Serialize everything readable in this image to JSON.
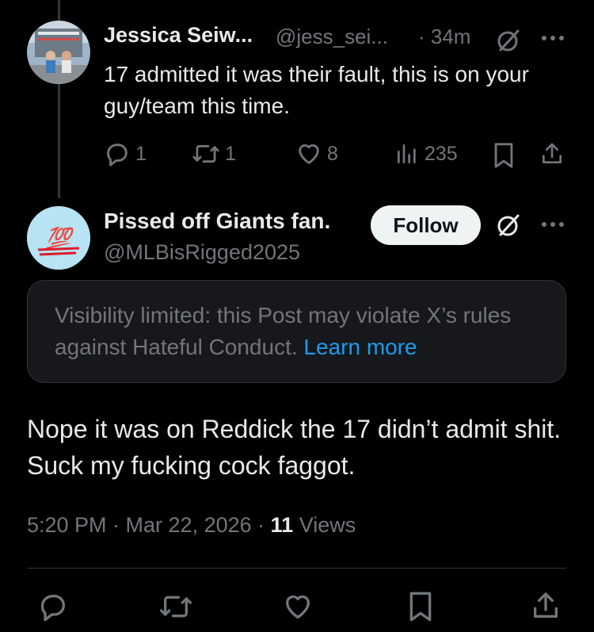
{
  "reply_tweet": {
    "author_name": "Jessica Seiw...",
    "handle": "@jess_sei...",
    "time": "· 34m",
    "text": "17 admitted it was their fault, this is on your guy/team this time.",
    "actions": {
      "replies": "1",
      "reposts": "1",
      "likes": "8",
      "views": "235"
    }
  },
  "main_tweet": {
    "author_name": "Pissed off Giants fan.",
    "handle": "@MLBisRigged2025",
    "avatar_emoji": "💯",
    "follow_label": "Follow",
    "notice_text": "Visibility limited: this Post may violate X’s rules against Hateful Conduct.",
    "notice_link": "Learn more",
    "text": "Nope it was on Reddick the 17 didn’t admit shit. Suck my fucking cock faggot.",
    "timestamp": "5:20 PM · Mar 22, 2026 · ",
    "views_count": "11",
    "views_label": " Views"
  },
  "colors": {
    "background": "#000000",
    "text_primary": "#e7e9ea",
    "text_secondary": "#71767b",
    "link": "#1d9bf0",
    "notice_bg": "#16181c"
  },
  "icons": [
    "reply-icon",
    "repost-icon",
    "like-icon",
    "views-icon",
    "bookmark-icon",
    "share-icon",
    "grok-icon",
    "more-icon"
  ]
}
